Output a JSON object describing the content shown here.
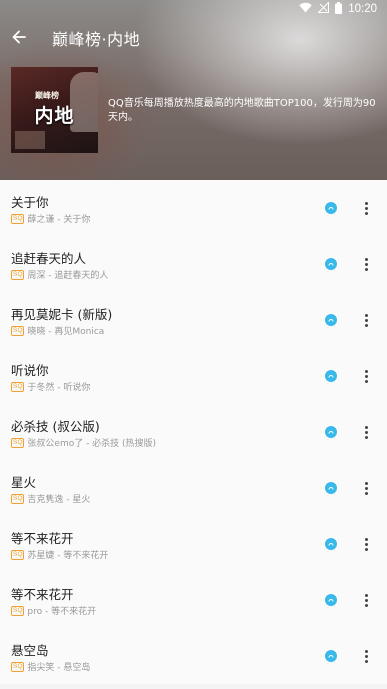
{
  "status_bar": {
    "time": "10:20"
  },
  "header": {
    "title": "巅峰榜·内地",
    "cover_small": "巅峰榜",
    "cover_big": "内地",
    "description": "QQ音乐每周播放热度最高的内地歌曲TOP100，发行周为90天内。"
  },
  "colors": {
    "accent": "#39b8ea",
    "badge": "#f0a030"
  },
  "badge_label": "SQ",
  "songs": [
    {
      "title": "关于你",
      "subtitle": "薛之谦 - 关于你"
    },
    {
      "title": "追赶春天的人",
      "subtitle": "周深 - 追赶春天的人"
    },
    {
      "title": "再见莫妮卡 (新版)",
      "subtitle": "晓晓 - 再见Monica"
    },
    {
      "title": "听说你",
      "subtitle": "于冬然 - 听说你"
    },
    {
      "title": "必杀技 (叔公版)",
      "subtitle": "张叔公emo了 - 必杀技 (热搜版)"
    },
    {
      "title": "星火",
      "subtitle": "吉克隽逸 - 星火"
    },
    {
      "title": "等不来花开",
      "subtitle": "苏星婕 - 等不来花开"
    },
    {
      "title": "等不来花开",
      "subtitle": "pro - 等不来花开"
    },
    {
      "title": "悬空岛",
      "subtitle": "指尖笑 - 悬空岛"
    }
  ]
}
